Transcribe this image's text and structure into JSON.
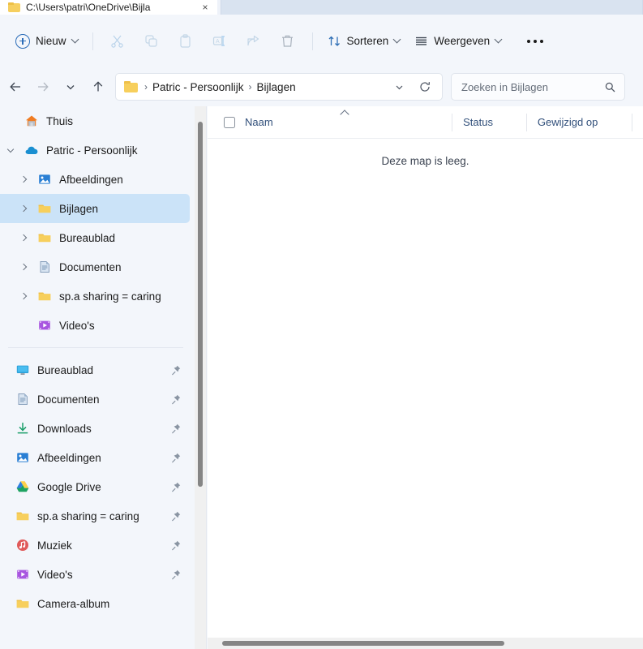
{
  "window": {
    "tab_title": "C:\\Users\\patri\\OneDrive\\Bijla",
    "tab_close": "×"
  },
  "toolbar": {
    "new_label": "Nieuw",
    "cut_icon": "scissors-icon",
    "copy_icon": "copy-icon",
    "paste_icon": "paste-icon",
    "rename_icon": "rename-icon",
    "share_icon": "share-icon",
    "delete_icon": "trash-icon",
    "sort_label": "Sorteren",
    "view_label": "Weergeven",
    "more_label": "..."
  },
  "address": {
    "back_icon": "arrow-left-icon",
    "forward_icon": "arrow-right-icon",
    "recent_icon": "chevron-down-icon",
    "up_icon": "arrow-up-icon",
    "crumbs": [
      {
        "label": "Patric - Persoonlijk"
      },
      {
        "label": "Bijlagen"
      }
    ],
    "separator": "›",
    "dropdown_icon": "chevron-down-icon",
    "refresh_icon": "refresh-icon"
  },
  "search": {
    "placeholder": "Zoeken in Bijlagen",
    "icon": "search-icon"
  },
  "sidebar": {
    "tree": [
      {
        "label": "Thuis",
        "icon": "home-icon",
        "expander": "none",
        "indent": 0,
        "selected": false
      },
      {
        "label": "Patric - Persoonlijk",
        "icon": "onedrive-cloud-icon",
        "expander": "expanded",
        "indent": 0,
        "selected": false
      },
      {
        "label": "Afbeeldingen",
        "icon": "pictures-icon",
        "expander": "collapsed",
        "indent": 1,
        "selected": false
      },
      {
        "label": "Bijlagen",
        "icon": "folder-icon",
        "expander": "collapsed",
        "indent": 1,
        "selected": true
      },
      {
        "label": "Bureaublad",
        "icon": "folder-icon",
        "expander": "collapsed",
        "indent": 1,
        "selected": false
      },
      {
        "label": "Documenten",
        "icon": "documents-icon",
        "expander": "collapsed",
        "indent": 1,
        "selected": false
      },
      {
        "label": "sp.a sharing = caring",
        "icon": "folder-icon",
        "expander": "collapsed",
        "indent": 1,
        "selected": false
      },
      {
        "label": "Video's",
        "icon": "videos-icon",
        "expander": "none",
        "indent": 1,
        "selected": false
      }
    ],
    "pinned": [
      {
        "label": "Bureaublad",
        "icon": "desktop-icon",
        "pinned": true
      },
      {
        "label": "Documenten",
        "icon": "documents-icon",
        "pinned": true
      },
      {
        "label": "Downloads",
        "icon": "download-icon",
        "pinned": true
      },
      {
        "label": "Afbeeldingen",
        "icon": "pictures-icon",
        "pinned": true
      },
      {
        "label": "Google Drive",
        "icon": "google-drive-icon",
        "pinned": true
      },
      {
        "label": "sp.a sharing = caring",
        "icon": "folder-icon",
        "pinned": true
      },
      {
        "label": "Muziek",
        "icon": "music-icon",
        "pinned": true
      },
      {
        "label": "Video's",
        "icon": "videos-icon",
        "pinned": true
      },
      {
        "label": "Camera-album",
        "icon": "folder-icon",
        "pinned": false
      }
    ]
  },
  "content": {
    "columns": [
      {
        "label": "Naam",
        "sorted": "asc"
      },
      {
        "label": "Status",
        "sorted": "none"
      },
      {
        "label": "Gewijzigd op",
        "sorted": "none"
      }
    ],
    "empty_message": "Deze map is leeg."
  },
  "colors": {
    "accent": "#2b6cb8",
    "selection": "#cbe3f8",
    "folder_yellow": "#f7cf5c",
    "header_text": "#32507b",
    "chrome_bg": "#f3f6fb"
  }
}
